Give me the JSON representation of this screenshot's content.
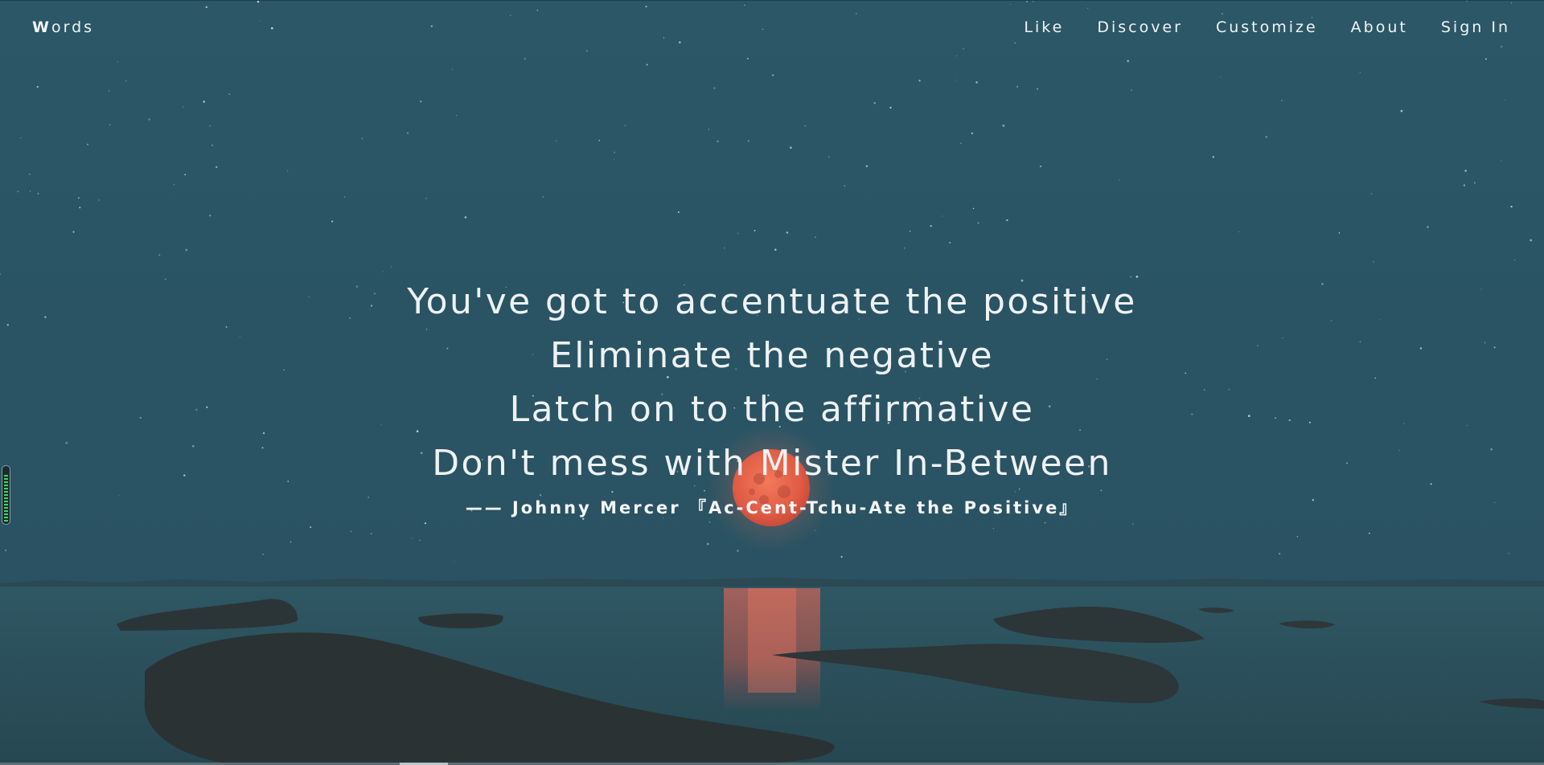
{
  "nav": {
    "brand_first": "W",
    "brand_rest": "ords",
    "links": [
      "Like",
      "Discover",
      "Customize",
      "About",
      "Sign In"
    ]
  },
  "quote": {
    "lines": [
      "You've got to accentuate the positive",
      "Eliminate the negative",
      "Latch on to the affirmative",
      "Don't mess with Mister In-Between"
    ],
    "attribution": "—— Johnny Mercer 『Ac-Cent-Tchu-Ate the Positive』"
  },
  "widgets": {
    "level_fraction": 0.88
  },
  "colors": {
    "sky": "#2a5666",
    "water": "#2b4d58",
    "moon": "#e8644a",
    "text": "#f2f4f5"
  }
}
